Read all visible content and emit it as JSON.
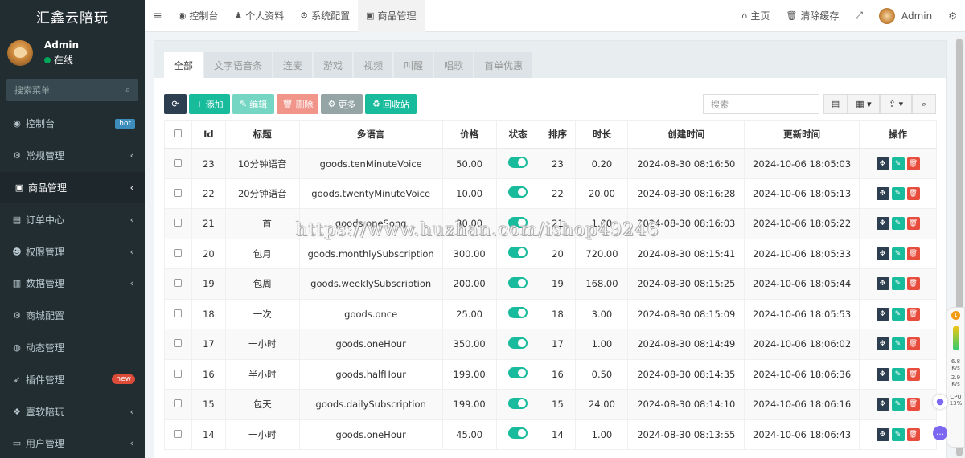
{
  "sidebar": {
    "brand": "汇鑫云陪玩",
    "user": {
      "name": "Admin",
      "status": "在线"
    },
    "search_placeholder": "搜索菜单",
    "items": [
      {
        "label": "控制台",
        "icon": "dashboard-icon",
        "badge": "hot"
      },
      {
        "label": "常规管理",
        "icon": "cogs-icon"
      },
      {
        "label": "商品管理",
        "icon": "shop-icon",
        "active": true
      },
      {
        "label": "订单中心",
        "icon": "file-icon"
      },
      {
        "label": "权限管理",
        "icon": "group-icon"
      },
      {
        "label": "数据管理",
        "icon": "bar-chart-icon"
      },
      {
        "label": "商城配置",
        "icon": "cogs-icon"
      },
      {
        "label": "动态管理",
        "icon": "activity-icon"
      },
      {
        "label": "插件管理",
        "icon": "rocket-icon",
        "badge": "new"
      },
      {
        "label": "壹软陪玩",
        "icon": "dropbox-icon"
      },
      {
        "label": "用户管理",
        "icon": "id-card-icon"
      }
    ]
  },
  "topbar": {
    "tabs": [
      {
        "label": "控制台",
        "icon": "dashboard-icon"
      },
      {
        "label": "个人资料",
        "icon": "user-icon"
      },
      {
        "label": "系统配置",
        "icon": "gear-icon"
      },
      {
        "label": "商品管理",
        "icon": "shop-icon",
        "active": true
      }
    ],
    "home": "主页",
    "clear_cache": "清除缓存",
    "admin": "Admin"
  },
  "content": {
    "tabs": [
      "全部",
      "文字语音条",
      "连麦",
      "游戏",
      "视频",
      "叫醒",
      "唱歌",
      "首单优惠"
    ],
    "toolbar": {
      "add": "添加",
      "edit": "编辑",
      "delete": "删除",
      "more": "更多",
      "recycle": "回收站",
      "search_placeholder": "搜索"
    },
    "columns": [
      "Id",
      "标题",
      "多语言",
      "价格",
      "状态",
      "排序",
      "时长",
      "创建时间",
      "更新时间",
      "操作"
    ],
    "rows": [
      [
        "23",
        "10分钟语音",
        "goods.tenMinuteVoice",
        "50.00",
        "23",
        "0.20",
        "2024-08-30 08:16:50",
        "2024-10-06 18:05:03"
      ],
      [
        "22",
        "20分钟语音",
        "goods.twentyMinuteVoice",
        "10.00",
        "22",
        "20.00",
        "2024-08-30 08:16:28",
        "2024-10-06 18:05:13"
      ],
      [
        "21",
        "一首",
        "goods.oneSong",
        "30.00",
        "21",
        "1.00",
        "2024-08-30 08:16:03",
        "2024-10-06 18:05:22"
      ],
      [
        "20",
        "包月",
        "goods.monthlySubscription",
        "300.00",
        "20",
        "720.00",
        "2024-08-30 08:15:41",
        "2024-10-06 18:05:33"
      ],
      [
        "19",
        "包周",
        "goods.weeklySubscription",
        "200.00",
        "19",
        "168.00",
        "2024-08-30 08:15:25",
        "2024-10-06 18:05:44"
      ],
      [
        "18",
        "一次",
        "goods.once",
        "25.00",
        "18",
        "3.00",
        "2024-08-30 08:15:09",
        "2024-10-06 18:05:53"
      ],
      [
        "17",
        "一小时",
        "goods.oneHour",
        "350.00",
        "17",
        "1.00",
        "2024-08-30 08:14:49",
        "2024-10-06 18:06:02"
      ],
      [
        "16",
        "半小时",
        "goods.halfHour",
        "199.00",
        "16",
        "0.50",
        "2024-08-30 08:14:35",
        "2024-10-06 18:06:36"
      ],
      [
        "15",
        "包天",
        "goods.dailySubscription",
        "199.00",
        "15",
        "24.00",
        "2024-08-30 08:14:10",
        "2024-10-06 18:06:16"
      ],
      [
        "14",
        "一小时",
        "goods.oneHour",
        "45.00",
        "14",
        "1.00",
        "2024-08-30 08:13:55",
        "2024-10-06 18:06:43"
      ]
    ]
  },
  "watermark": "https://www.huzhan.com/ishop49246",
  "widget": {
    "badge": "1",
    "v1": "6.8",
    "u1": "K/s",
    "v2": "2.9",
    "u2": "K/s",
    "cpu_label": "CPU",
    "cpu": "13%"
  },
  "colors": {
    "sidebar": "#222d32",
    "accent": "#18bc9c",
    "danger": "#e74c3c",
    "primary": "#2c3e50"
  }
}
